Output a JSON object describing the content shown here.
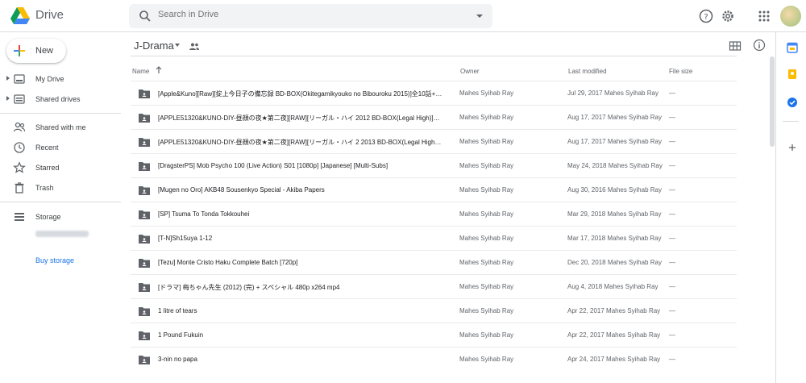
{
  "app": {
    "name": "Drive"
  },
  "search": {
    "placeholder": "Search in Drive"
  },
  "sidebar": {
    "new_label": "New",
    "items": [
      {
        "label": "My Drive",
        "icon": "my-drive-icon"
      },
      {
        "label": "Shared drives",
        "icon": "shared-drives-icon"
      },
      {
        "label": "Shared with me",
        "icon": "people-icon"
      },
      {
        "label": "Recent",
        "icon": "clock-icon"
      },
      {
        "label": "Starred",
        "icon": "star-icon"
      },
      {
        "label": "Trash",
        "icon": "trash-icon"
      }
    ],
    "storage_label": "Storage",
    "buy_storage": "Buy storage"
  },
  "main": {
    "folder_title": "J-Drama",
    "columns": {
      "name": "Name",
      "owner": "Owner",
      "modified": "Last modified",
      "size": "File size"
    },
    "rows": [
      {
        "name": "[Apple&Kuno][Raw][掟上今日子の備忘録 BD-BOX(Okitegamikyouko no Bibouroku 2015)]全10話+特...",
        "owner": "Mahes Syihab Ray",
        "modified": "Jul 29, 2017  Mahes Syihab Ray",
        "size": "—"
      },
      {
        "name": "[APPLE51320&KUNO-DIY-昼顔の夜★第二夜][RAW][リーガル・ハイ 2012 BD-BOX(Legal High)]全11...",
        "owner": "Mahes Syihab Ray",
        "modified": "Aug 17, 2017  Mahes Syihab Ray",
        "size": "—"
      },
      {
        "name": "[APPLE51320&KUNO-DIY-昼顔の夜★第二夜][RAW][リーガル・ハイ 2 2013 BD-BOX(Legal High2)]全1...",
        "owner": "Mahes Syihab Ray",
        "modified": "Aug 17, 2017  Mahes Syihab Ray",
        "size": "—"
      },
      {
        "name": "[DragsterPS] Mob Psycho 100 (Live Action) S01 [1080p] [Japanese] [Multi-Subs]",
        "owner": "Mahes Syihab Ray",
        "modified": "May 24, 2018  Mahes Syihab Ray",
        "size": "—"
      },
      {
        "name": "[Mugen no Oro] AKB48 Sousenkyo Special - Akiba Papers",
        "owner": "Mahes Syihab Ray",
        "modified": "Aug 30, 2016  Mahes Syihab Ray",
        "size": "—"
      },
      {
        "name": "[SP] Tsuma To Tonda Tokkouhei",
        "owner": "Mahes Syihab Ray",
        "modified": "Mar 29, 2018  Mahes Syihab Ray",
        "size": "—"
      },
      {
        "name": "[T-N]Sh15uya 1-12",
        "owner": "Mahes Syihab Ray",
        "modified": "Mar 17, 2018  Mahes Syihab Ray",
        "size": "—"
      },
      {
        "name": "[Tezu] Monte Cristo Haku Complete Batch [720p]",
        "owner": "Mahes Syihab Ray",
        "modified": "Dec 20, 2018  Mahes Syihab Ray",
        "size": "—"
      },
      {
        "name": "[ドラマ] 梅ちゃん先生 (2012) (完) + スペシャル 480p x264 mp4",
        "owner": "Mahes Syihab Ray",
        "modified": "Aug 4, 2018  Mahes Syihab Ray",
        "size": "—"
      },
      {
        "name": "1 litre of tears",
        "owner": "Mahes Syihab Ray",
        "modified": "Apr 22, 2017  Mahes Syihab Ray",
        "size": "—"
      },
      {
        "name": "1 Pound Fukuin",
        "owner": "Mahes Syihab Ray",
        "modified": "Apr 22, 2017  Mahes Syihab Ray",
        "size": "—"
      },
      {
        "name": "3-nin no papa",
        "owner": "Mahes Syihab Ray",
        "modified": "Apr 24, 2017  Mahes Syihab Ray",
        "size": "—"
      }
    ]
  },
  "colors": {
    "accent": "#1a73e8",
    "divider": "#dadce0",
    "folder": "#5f6368"
  }
}
